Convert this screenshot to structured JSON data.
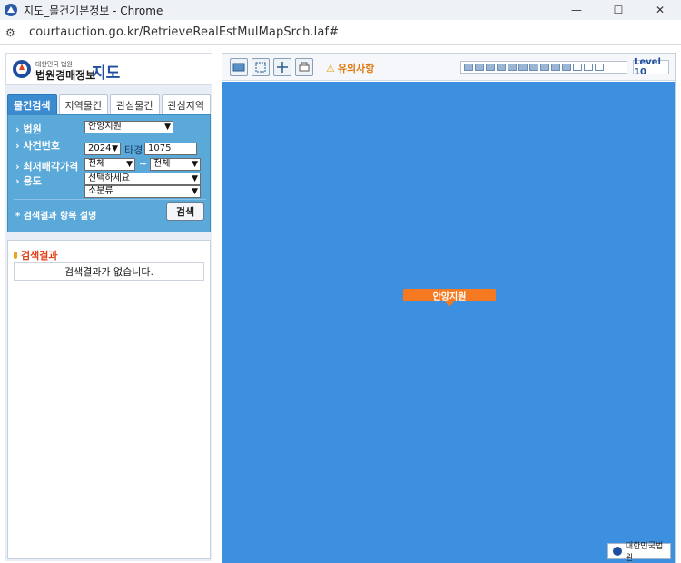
{
  "window": {
    "title": "지도_물건기본정보 - Chrome",
    "url": "courtauction.go.kr/RetrieveRealEstMulMapSrch.laf#"
  },
  "logo": {
    "small": "대한민국 법원",
    "big": "법원경매정보",
    "map": "지도"
  },
  "tabs": [
    "물건검색",
    "지역물건",
    "관심물건",
    "관심지역"
  ],
  "search": {
    "court_label": "법원",
    "court_value": "안양지원",
    "case_label": "사건번호",
    "case_year": "2024",
    "case_type": "타경",
    "case_number": "1075",
    "price_label": "최저매각가격",
    "price_from": "전체",
    "price_tilde": "~",
    "price_to": "전체",
    "use_label": "용도",
    "use_major": "선택하세요",
    "use_minor": "소분류",
    "help_text": "* 검색결과 항목 설명",
    "search_button": "검색"
  },
  "results": {
    "title": "검색결과",
    "empty_message": "검색결과가 없습니다."
  },
  "map": {
    "warning": "유의사항",
    "level": "Level 10",
    "marker_label": "안양지원",
    "court_logo": "대한민국법원",
    "zoom_segments_total": 13,
    "zoom_segments_filled": 10
  }
}
